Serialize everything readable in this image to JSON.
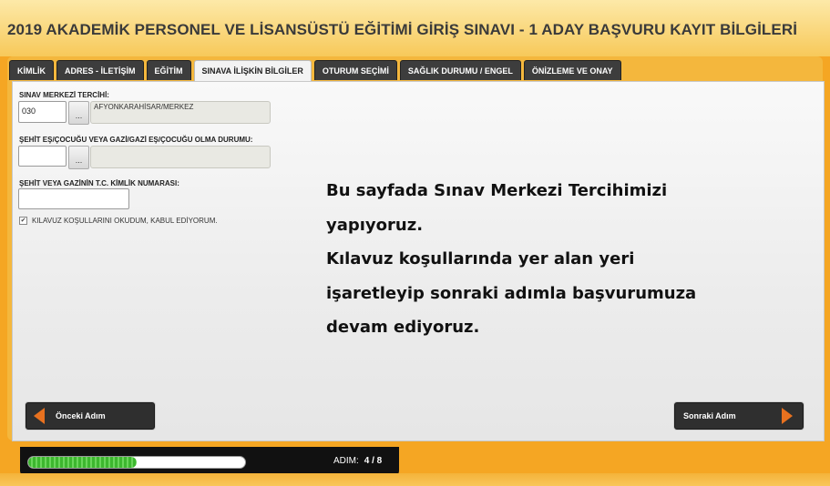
{
  "header": {
    "title": "2019 AKADEMİK PERSONEL VE LİSANSÜSTÜ EĞİTİMİ GİRİŞ SINAVI - 1 ADAY BAŞVURU KAYIT BİLGİLERİ"
  },
  "tabs": [
    {
      "label": "KİMLİK",
      "active": false
    },
    {
      "label": "ADRES - İLETİŞİM",
      "active": false
    },
    {
      "label": "EĞİTİM",
      "active": false
    },
    {
      "label": "SINAVA İLİŞKİN BİLGİLER",
      "active": true
    },
    {
      "label": "OTURUM SEÇİMİ",
      "active": false
    },
    {
      "label": "SAĞLIK DURUMU / ENGEL",
      "active": false
    },
    {
      "label": "ÖNİZLEME VE ONAY",
      "active": false
    }
  ],
  "form": {
    "exam_center": {
      "label": "SINAV MERKEZİ TERCİHİ:",
      "code_value": "030",
      "button_label": "...",
      "display_value": "AFYONKARAHİSAR/MERKEZ"
    },
    "martyr_status": {
      "label": "ŞEHİT EŞ/ÇOCUĞU VEYA GAZİ/GAZİ EŞ/ÇOCUĞU OLMA DURUMU:",
      "code_value": "",
      "button_label": "...",
      "display_value": ""
    },
    "martyr_id": {
      "label": "ŞEHİT VEYA GAZİNİN T.C. KİMLİK NUMARASI:",
      "value": ""
    },
    "guide_checkbox": {
      "label": "KILAVUZ KOŞULLARINI OKUDUM, KABUL EDİYORUM.",
      "checked": true,
      "check_mark": "✔"
    }
  },
  "overlay": {
    "lines": [
      "Bu sayfada Sınav Merkezi Tercihimizi",
      "yapıyoruz.",
      "Kılavuz koşullarında yer alan yeri",
      "işaretleyip sonraki adımla başvurumuza",
      "devam ediyoruz."
    ]
  },
  "navigation": {
    "prev_label": "Önceki Adım",
    "next_label": "Sonraki Adım",
    "accent_color": "#e8711f"
  },
  "footer": {
    "progress_fraction": 0.5,
    "step_label": "ADIM:",
    "step_value": "4 / 8"
  }
}
